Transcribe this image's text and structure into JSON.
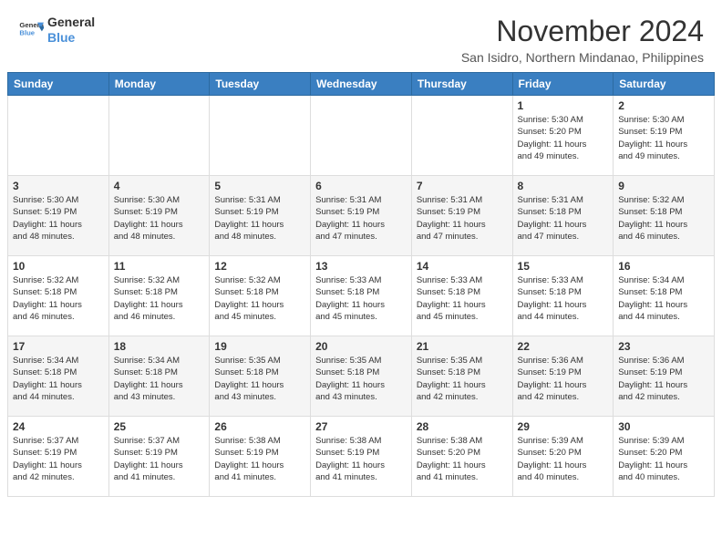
{
  "header": {
    "logo_line1": "General",
    "logo_line2": "Blue",
    "month_title": "November 2024",
    "location": "San Isidro, Northern Mindanao, Philippines"
  },
  "days_of_week": [
    "Sunday",
    "Monday",
    "Tuesday",
    "Wednesday",
    "Thursday",
    "Friday",
    "Saturday"
  ],
  "weeks": [
    [
      {
        "day": "",
        "info": ""
      },
      {
        "day": "",
        "info": ""
      },
      {
        "day": "",
        "info": ""
      },
      {
        "day": "",
        "info": ""
      },
      {
        "day": "",
        "info": ""
      },
      {
        "day": "1",
        "info": "Sunrise: 5:30 AM\nSunset: 5:20 PM\nDaylight: 11 hours\nand 49 minutes."
      },
      {
        "day": "2",
        "info": "Sunrise: 5:30 AM\nSunset: 5:19 PM\nDaylight: 11 hours\nand 49 minutes."
      }
    ],
    [
      {
        "day": "3",
        "info": "Sunrise: 5:30 AM\nSunset: 5:19 PM\nDaylight: 11 hours\nand 48 minutes."
      },
      {
        "day": "4",
        "info": "Sunrise: 5:30 AM\nSunset: 5:19 PM\nDaylight: 11 hours\nand 48 minutes."
      },
      {
        "day": "5",
        "info": "Sunrise: 5:31 AM\nSunset: 5:19 PM\nDaylight: 11 hours\nand 48 minutes."
      },
      {
        "day": "6",
        "info": "Sunrise: 5:31 AM\nSunset: 5:19 PM\nDaylight: 11 hours\nand 47 minutes."
      },
      {
        "day": "7",
        "info": "Sunrise: 5:31 AM\nSunset: 5:19 PM\nDaylight: 11 hours\nand 47 minutes."
      },
      {
        "day": "8",
        "info": "Sunrise: 5:31 AM\nSunset: 5:18 PM\nDaylight: 11 hours\nand 47 minutes."
      },
      {
        "day": "9",
        "info": "Sunrise: 5:32 AM\nSunset: 5:18 PM\nDaylight: 11 hours\nand 46 minutes."
      }
    ],
    [
      {
        "day": "10",
        "info": "Sunrise: 5:32 AM\nSunset: 5:18 PM\nDaylight: 11 hours\nand 46 minutes."
      },
      {
        "day": "11",
        "info": "Sunrise: 5:32 AM\nSunset: 5:18 PM\nDaylight: 11 hours\nand 46 minutes."
      },
      {
        "day": "12",
        "info": "Sunrise: 5:32 AM\nSunset: 5:18 PM\nDaylight: 11 hours\nand 45 minutes."
      },
      {
        "day": "13",
        "info": "Sunrise: 5:33 AM\nSunset: 5:18 PM\nDaylight: 11 hours\nand 45 minutes."
      },
      {
        "day": "14",
        "info": "Sunrise: 5:33 AM\nSunset: 5:18 PM\nDaylight: 11 hours\nand 45 minutes."
      },
      {
        "day": "15",
        "info": "Sunrise: 5:33 AM\nSunset: 5:18 PM\nDaylight: 11 hours\nand 44 minutes."
      },
      {
        "day": "16",
        "info": "Sunrise: 5:34 AM\nSunset: 5:18 PM\nDaylight: 11 hours\nand 44 minutes."
      }
    ],
    [
      {
        "day": "17",
        "info": "Sunrise: 5:34 AM\nSunset: 5:18 PM\nDaylight: 11 hours\nand 44 minutes."
      },
      {
        "day": "18",
        "info": "Sunrise: 5:34 AM\nSunset: 5:18 PM\nDaylight: 11 hours\nand 43 minutes."
      },
      {
        "day": "19",
        "info": "Sunrise: 5:35 AM\nSunset: 5:18 PM\nDaylight: 11 hours\nand 43 minutes."
      },
      {
        "day": "20",
        "info": "Sunrise: 5:35 AM\nSunset: 5:18 PM\nDaylight: 11 hours\nand 43 minutes."
      },
      {
        "day": "21",
        "info": "Sunrise: 5:35 AM\nSunset: 5:18 PM\nDaylight: 11 hours\nand 42 minutes."
      },
      {
        "day": "22",
        "info": "Sunrise: 5:36 AM\nSunset: 5:19 PM\nDaylight: 11 hours\nand 42 minutes."
      },
      {
        "day": "23",
        "info": "Sunrise: 5:36 AM\nSunset: 5:19 PM\nDaylight: 11 hours\nand 42 minutes."
      }
    ],
    [
      {
        "day": "24",
        "info": "Sunrise: 5:37 AM\nSunset: 5:19 PM\nDaylight: 11 hours\nand 42 minutes."
      },
      {
        "day": "25",
        "info": "Sunrise: 5:37 AM\nSunset: 5:19 PM\nDaylight: 11 hours\nand 41 minutes."
      },
      {
        "day": "26",
        "info": "Sunrise: 5:38 AM\nSunset: 5:19 PM\nDaylight: 11 hours\nand 41 minutes."
      },
      {
        "day": "27",
        "info": "Sunrise: 5:38 AM\nSunset: 5:19 PM\nDaylight: 11 hours\nand 41 minutes."
      },
      {
        "day": "28",
        "info": "Sunrise: 5:38 AM\nSunset: 5:20 PM\nDaylight: 11 hours\nand 41 minutes."
      },
      {
        "day": "29",
        "info": "Sunrise: 5:39 AM\nSunset: 5:20 PM\nDaylight: 11 hours\nand 40 minutes."
      },
      {
        "day": "30",
        "info": "Sunrise: 5:39 AM\nSunset: 5:20 PM\nDaylight: 11 hours\nand 40 minutes."
      }
    ]
  ]
}
